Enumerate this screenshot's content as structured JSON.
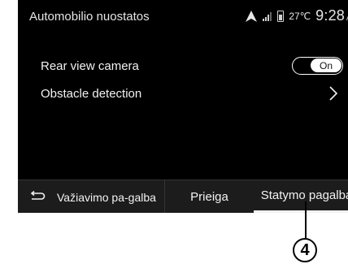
{
  "status_bar": {
    "title": "Automobilio nuostatos",
    "temperature": "27℃",
    "time": "9:28",
    "ampm": "AM",
    "icons": [
      "navigation-icon",
      "signal-icon",
      "battery-icon"
    ]
  },
  "settings": [
    {
      "label": "Rear view camera",
      "control": "toggle",
      "value": "On"
    },
    {
      "label": "Obstacle detection",
      "control": "chevron",
      "value": ">"
    }
  ],
  "bottom_tabs": [
    {
      "label": "Važiavimo pa-galba"
    },
    {
      "label": "Prieiga"
    },
    {
      "label": "Statymo pagalba",
      "selected": true
    }
  ],
  "callout": "4",
  "colors": {
    "screen_bg": "#000000",
    "bar_bg": "#1c1c1c",
    "text": "#f2f2f2"
  }
}
